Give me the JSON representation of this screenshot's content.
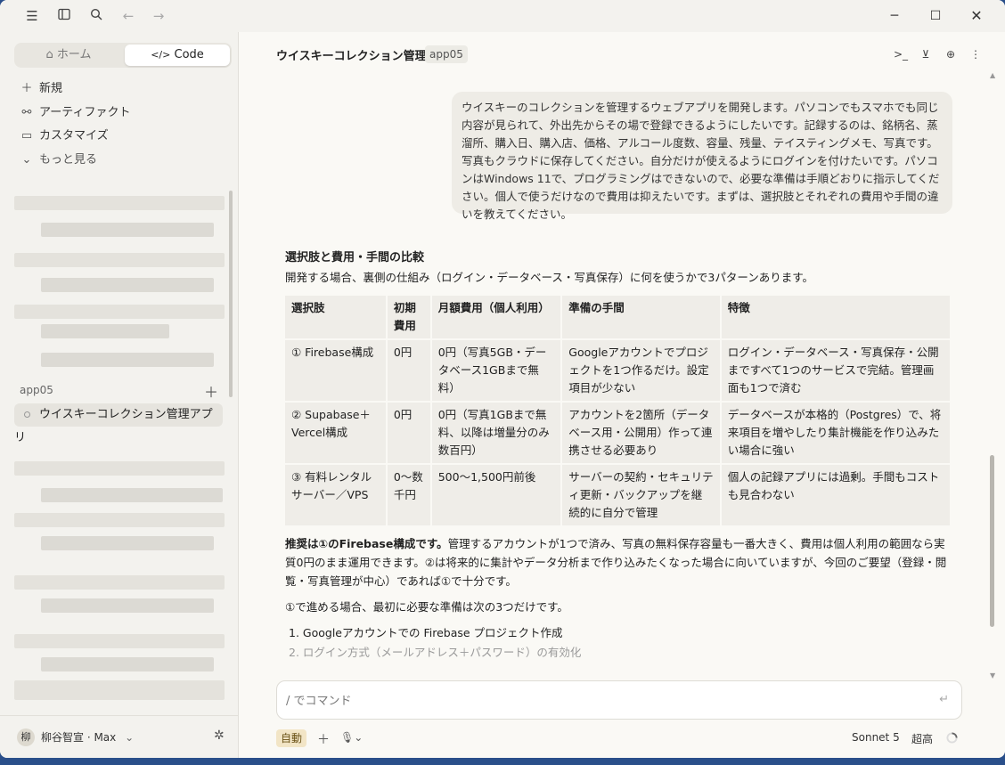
{
  "titlebar": {
    "icons": [
      "menu-icon",
      "sidebar-toggle-icon",
      "search-icon",
      "back-arrow-icon",
      "forward-arrow-icon"
    ],
    "window_controls": [
      "minimize-icon",
      "maximize-icon",
      "close-icon"
    ]
  },
  "sidebar": {
    "tabs": [
      {
        "label": "ホーム",
        "icon": "home-icon",
        "active": false
      },
      {
        "label": "Code",
        "icon": "code-icon",
        "active": true
      }
    ],
    "nav": [
      {
        "label": "新規",
        "icon": "plus-icon"
      },
      {
        "label": "アーティファクト",
        "icon": "artifact-icon"
      },
      {
        "label": "カスタマイズ",
        "icon": "briefcase-icon"
      },
      {
        "label": "もっと見る",
        "icon": "chevron-down-icon"
      }
    ],
    "project": {
      "label": "app05",
      "add_icon": "plus-icon"
    },
    "active_chat": "ウイスキーコレクション管理アプリ",
    "user": {
      "avatar": "柳",
      "name": "柳谷智宣 · Max"
    }
  },
  "header": {
    "title": "ウイスキーコレクション管理アプリ",
    "tag": "app05",
    "icons": [
      "terminal-icon",
      "download-icon",
      "globe-icon",
      "more-vertical-icon"
    ]
  },
  "user_message": "ウイスキーのコレクションを管理するウェブアプリを開発します。パソコンでもスマホでも同じ内容が見られて、外出先からその場で登録できるようにしたいです。記録するのは、銘柄名、蒸溜所、購入日、購入店、価格、アルコール度数、容量、残量、テイスティングメモ、写真です。写真もクラウドに保存してください。自分だけが使えるようにログインを付けたいです。パソコンはWindows 11で、プログラミングはできないので、必要な準備は手順どおりに指示してください。個人で使うだけなので費用は抑えたいです。まずは、選択肢とそれぞれの費用や手間の違いを教えてください。",
  "response": {
    "heading": "選択肢と費用・手間の比較",
    "intro": "開発する場合、裏側の仕組み（ログイン・データベース・写真保存）に何を使うかで3パターンあります。",
    "table": {
      "headers": [
        "選択肢",
        "初期費用",
        "月額費用（個人利用）",
        "準備の手間",
        "特徴"
      ],
      "rows": [
        [
          "① Firebase構成",
          "0円",
          "0円（写真5GB・データベース1GBまで無料）",
          "Googleアカウントでプロジェクトを1つ作るだけ。設定項目が少ない",
          "ログイン・データベース・写真保存・公開まですべて1つのサービスで完結。管理画面も1つで済む"
        ],
        [
          "② Supabase＋Vercel構成",
          "0円",
          "0円（写真1GBまで無料、以降は増量分のみ数百円）",
          "アカウントを2箇所（データベース用・公開用）作って連携させる必要あり",
          "データベースが本格的（Postgres）で、将来項目を増やしたり集計機能を作り込みたい場合に強い"
        ],
        [
          "③ 有料レンタルサーバー／VPS",
          "0〜数千円",
          "500〜1,500円前後",
          "サーバーの契約・セキュリティ更新・バックアップを継続的に自分で管理",
          "個人の記録アプリには過剰。手間もコストも見合わない"
        ]
      ]
    },
    "recommend_bold": "推奨は①のFirebase構成です。",
    "recommend_rest": "管理するアカウントが1つで済み、写真の無料保存容量も一番大きく、費用は個人利用の範囲なら実質0円のまま運用できます。②は将来的に集計やデータ分析まで作り込みたくなった場合に向いていますが、今回のご要望（登録・閲覧・写真管理が中心）であれば①で十分です。",
    "steps_intro": "①で進める場合、最初に必要な準備は次の3つだけです。",
    "steps": [
      "1. Googleアカウントでの Firebase プロジェクト作成",
      "2. ログイン方式（メールアドレス＋パスワード）の有効化"
    ]
  },
  "input": {
    "placeholder": "/ でコマンド",
    "send_icon": "send-icon"
  },
  "bottom_bar": {
    "mode": "自動",
    "add_icon": "plus-icon",
    "mic_icon": "mic-icon",
    "model": "Sonnet 5",
    "effort": "超高",
    "spinner_icon": "loading-spinner-icon"
  }
}
